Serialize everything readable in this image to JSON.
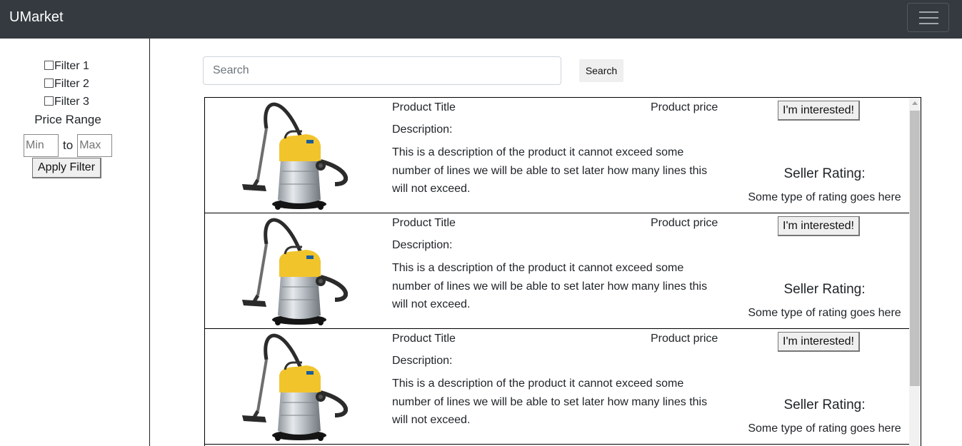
{
  "navbar": {
    "brand": "UMarket",
    "toggle_icon": "hamburger-menu-icon"
  },
  "sidebar": {
    "filters": [
      {
        "label": "Filter 1",
        "checked": false
      },
      {
        "label": "Filter 2",
        "checked": false
      },
      {
        "label": "Filter 3",
        "checked": false
      }
    ],
    "price_range_label": "Price Range",
    "min_placeholder": "Min",
    "to_label": "to",
    "max_placeholder": "Max",
    "apply_label": "Apply Filter"
  },
  "search": {
    "placeholder": "Search",
    "button_label": "Search"
  },
  "products": [
    {
      "title": "Product Title",
      "price": "Product price",
      "description_label": "Description:",
      "description": "This is a description of the product it cannot exceed some number of lines we will be able to set later how many lines this will not exceed.",
      "interest_label": "I'm interested!",
      "seller_rating_label": "Seller Rating:",
      "rating_text": "Some type of rating goes here",
      "image": "wet-dry-vacuum-cleaner"
    },
    {
      "title": "Product Title",
      "price": "Product price",
      "description_label": "Description:",
      "description": "This is a description of the product it cannot exceed some number of lines we will be able to set later how many lines this will not exceed.",
      "interest_label": "I'm interested!",
      "seller_rating_label": "Seller Rating:",
      "rating_text": "Some type of rating goes here",
      "image": "wet-dry-vacuum-cleaner"
    },
    {
      "title": "Product Title",
      "price": "Product price",
      "description_label": "Description:",
      "description": "This is a description of the product it cannot exceed some number of lines we will be able to set later how many lines this will not exceed.",
      "interest_label": "I'm interested!",
      "seller_rating_label": "Seller Rating:",
      "rating_text": "Some type of rating goes here",
      "image": "wet-dry-vacuum-cleaner"
    }
  ],
  "colors": {
    "navbar_bg": "#343a40",
    "vacuum_body": "#f2c42c",
    "vacuum_tank": "#b9bfc4"
  }
}
